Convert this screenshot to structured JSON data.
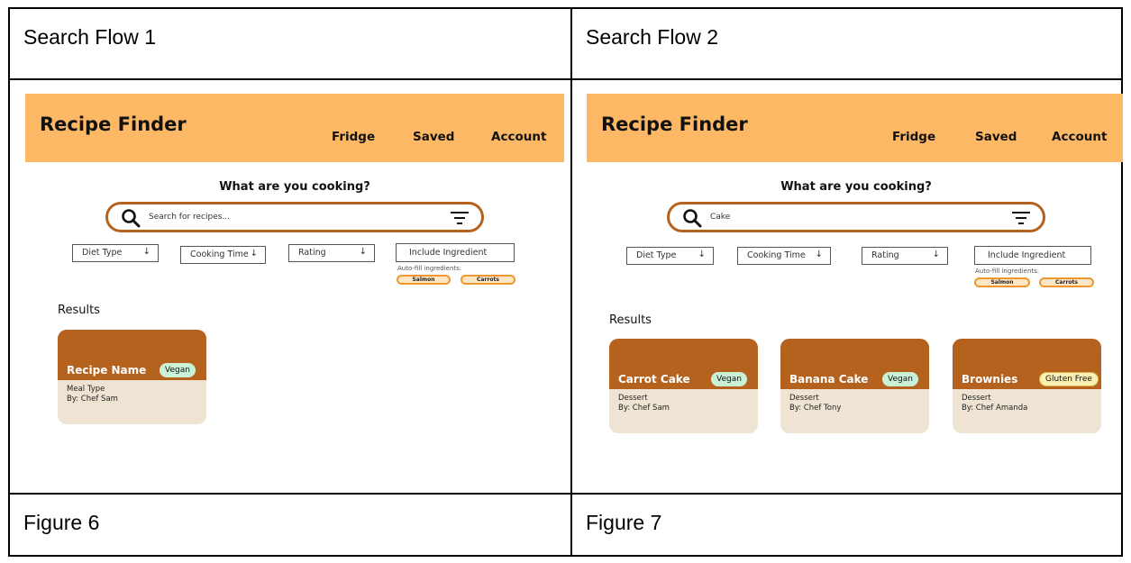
{
  "panels": [
    {
      "heading": "Search Flow 1",
      "figure": "Figure 6",
      "app": {
        "title": "Recipe Finder",
        "nav": [
          "Fridge",
          "Saved",
          "Account"
        ],
        "prompt": "What are you cooking?",
        "search": {
          "value": "",
          "placeholder": "Search for recipes..."
        },
        "filters": [
          {
            "label": "Diet Type",
            "arrow": "↓"
          },
          {
            "label": "Cooking Time",
            "arrow": "↓"
          },
          {
            "label": "Rating",
            "arrow": "↓"
          }
        ],
        "ingredient_field": "Include Ingredient",
        "autofill_label": "Auto-fill ingredients:",
        "chips": [
          "Salmon",
          "Carrots"
        ],
        "results_label": "Results",
        "cards": [
          {
            "name": "Recipe Name",
            "badge": "Vegan",
            "meal": "Meal Type",
            "author": "By: Chef Sam"
          }
        ]
      }
    },
    {
      "heading": "Search Flow 2",
      "figure": "Figure 7",
      "app": {
        "title": "Recipe Finder",
        "nav": [
          "Fridge",
          "Saved",
          "Account"
        ],
        "prompt": "What are you cooking?",
        "search": {
          "value": "Cake",
          "placeholder": ""
        },
        "filters": [
          {
            "label": "Diet Type",
            "arrow": "↓"
          },
          {
            "label": "Cooking Time",
            "arrow": "↓"
          },
          {
            "label": "Rating",
            "arrow": "↓"
          }
        ],
        "ingredient_field": "Include Ingredient",
        "autofill_label": "Auto-fill ingredients:",
        "chips": [
          "Salmon",
          "Carrots"
        ],
        "results_label": "Results",
        "cards": [
          {
            "name": "Carrot Cake",
            "badge": "Vegan",
            "meal": "Dessert",
            "author": "By: Chef Sam"
          },
          {
            "name": "Banana Cake",
            "badge": "Vegan",
            "meal": "Dessert",
            "author": "By: Chef Tony"
          },
          {
            "name": "Brownies",
            "badge": "Gluten Free",
            "meal": "Dessert",
            "author": "By: Chef Amanda"
          }
        ]
      }
    }
  ],
  "colors": {
    "header_bg": "#fdb865",
    "accent_brown": "#b5621f",
    "card_body": "#efe4d4",
    "vegan_badge": "#c9f1d6",
    "gluten_free_badge": "#fbefb1",
    "chip_border": "#f0962e"
  },
  "icons": {
    "search": "search-icon",
    "filter": "filter-icon",
    "dropdown": "arrow-down-icon"
  }
}
